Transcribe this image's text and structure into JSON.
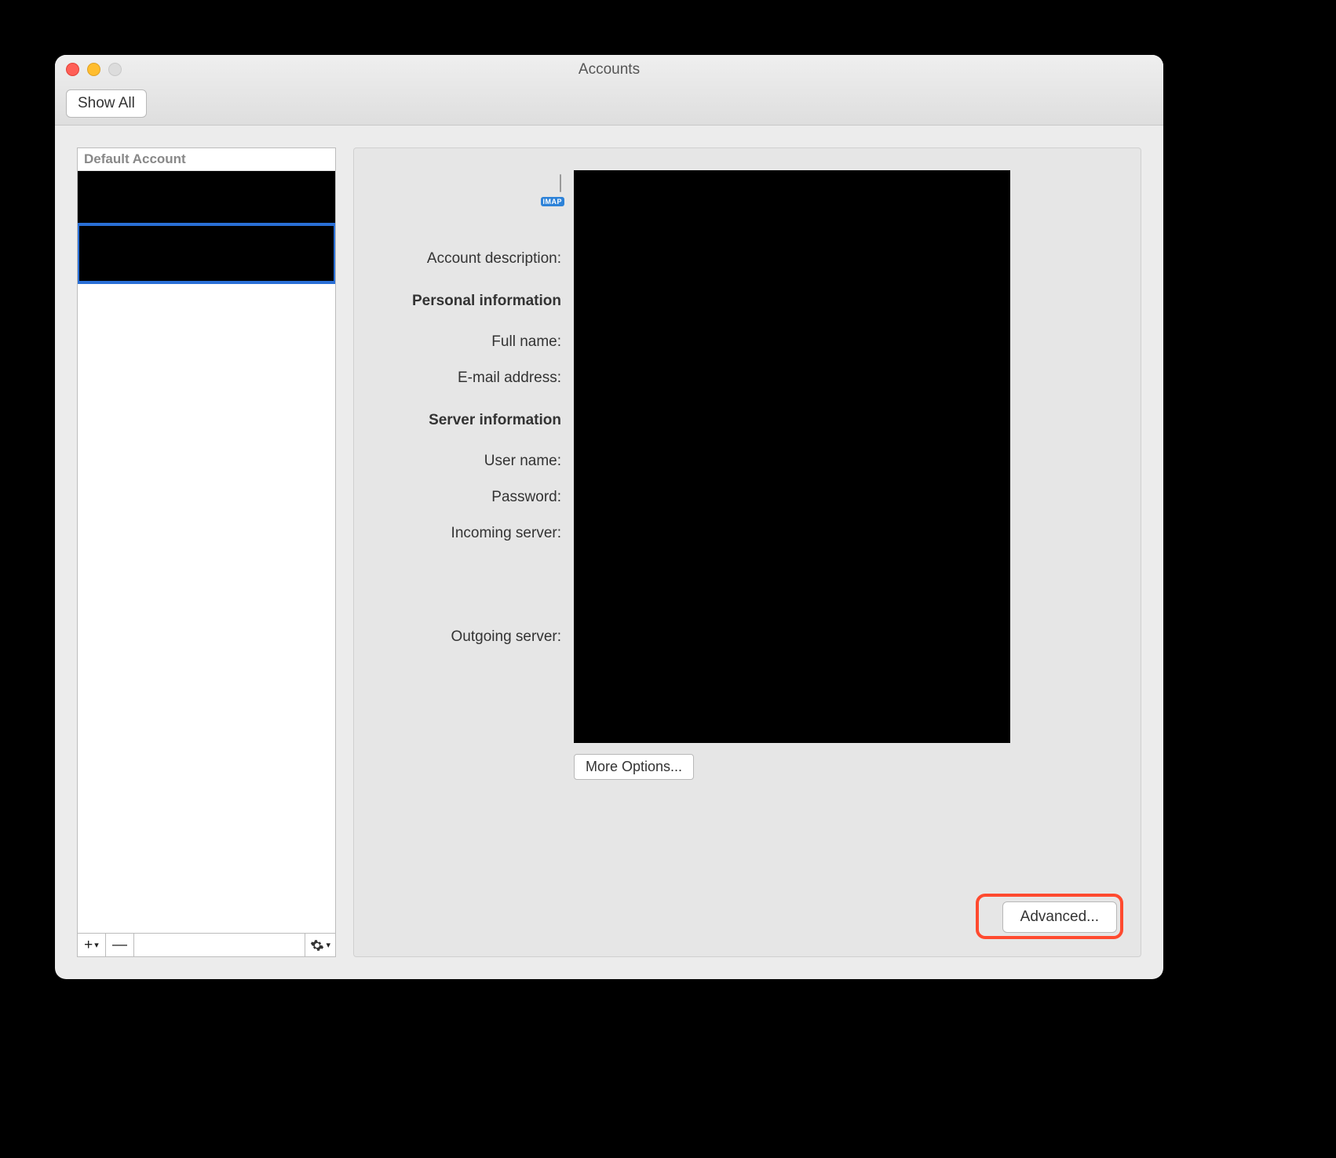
{
  "window": {
    "title": "Accounts",
    "show_all_label": "Show All"
  },
  "sidebar": {
    "header": "Default Account",
    "accounts": [
      {
        "label": ""
      },
      {
        "label": ""
      }
    ],
    "toolbar": {
      "add_label": "+",
      "remove_label": "—"
    }
  },
  "form": {
    "imap_badge": "IMAP",
    "account_description_label": "Account description:",
    "personal_info_header": "Personal information",
    "full_name_label": "Full name:",
    "email_label": "E-mail address:",
    "server_info_header": "Server information",
    "username_label": "User name:",
    "password_label": "Password:",
    "incoming_label": "Incoming server:",
    "outgoing_label": "Outgoing server:",
    "more_options_label": "More Options...",
    "advanced_label": "Advanced..."
  }
}
